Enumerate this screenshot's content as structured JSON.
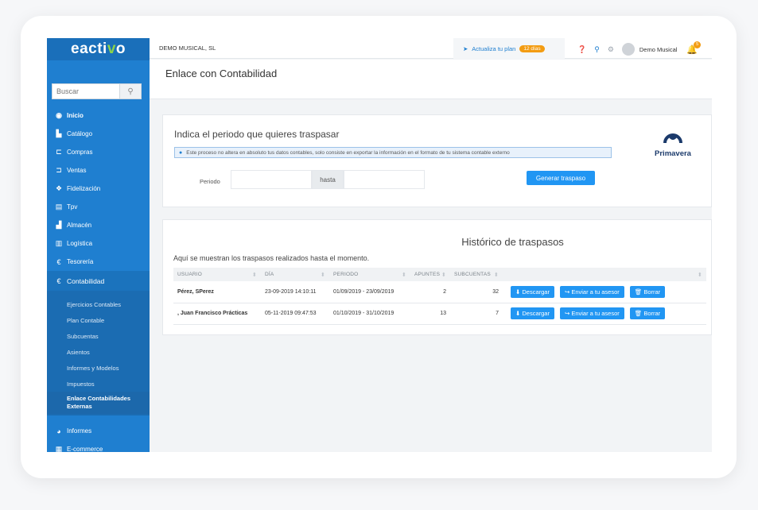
{
  "brand": {
    "prefix": "eacti",
    "v": "v",
    "suffix": "o"
  },
  "search": {
    "placeholder": "Buscar"
  },
  "nav": [
    {
      "icon": "home-icon",
      "glyph": "◉",
      "label": "Inicio"
    },
    {
      "icon": "catalog-icon",
      "glyph": "▙",
      "label": "Catálogo"
    },
    {
      "icon": "purchases-icon",
      "glyph": "⊏",
      "label": "Compras"
    },
    {
      "icon": "sales-icon",
      "glyph": "⊐",
      "label": "Ventas"
    },
    {
      "icon": "gift-icon",
      "glyph": "❖",
      "label": "Fidelización"
    },
    {
      "icon": "tpv-icon",
      "glyph": "▤",
      "label": "Tpv"
    },
    {
      "icon": "warehouse-icon",
      "glyph": "▟",
      "label": "Almacén"
    },
    {
      "icon": "logistics-icon",
      "glyph": "▥",
      "label": "Logística"
    },
    {
      "icon": "treasury-icon",
      "glyph": "€",
      "label": "Tesorería"
    }
  ],
  "nav_section": {
    "glyph": "€",
    "label": "Contabilidad"
  },
  "submenu": [
    "Ejercicios Contables",
    "Plan Contable",
    "Subcuentas",
    "Asientos",
    "Informes y Modelos",
    "Impuestos"
  ],
  "submenu_current": "Enlace Contabilidades Externas",
  "nav_bottom": [
    {
      "icon": "reports-icon",
      "glyph": "◕",
      "label": "Informes"
    },
    {
      "icon": "ecommerce-icon",
      "glyph": "▦",
      "label": "E-commerce"
    }
  ],
  "topbar": {
    "company": "DEMO MUSICAL, SL",
    "upgrade_label": "Actualiza tu plan",
    "upgrade_badge": "12 días",
    "user": "Demo Musical",
    "bell_count": "5"
  },
  "page": {
    "title": "Enlace con Contabilidad"
  },
  "period_panel": {
    "title": "Indica el periodo que quieres traspasar",
    "info": "Este proceso no altera en absoluto tus datos contables, solo consiste en exportar la información en el formato de tu sistema contable externo",
    "period_label": "Periodo",
    "to_label": "hasta",
    "generate_button": "Generar traspaso",
    "software": "Primavera"
  },
  "history": {
    "title": "Histórico de traspasos",
    "subtitle": "Aquí se muestran los traspasos realizados hasta el momento.",
    "columns": [
      "USUARIO",
      "DÍA",
      "PERIODO",
      "APUNTES",
      "SUBCUENTAS"
    ],
    "rows": [
      {
        "user": "Pérez, SPerez",
        "day": "23-09-2019 14:10:11",
        "period": "01/09/2019 - 23/09/2019",
        "entries": "2",
        "accounts": "32"
      },
      {
        "user": ", Juan Francisco Prácticas",
        "day": "05-11-2019 09:47:53",
        "period": "01/10/2019 - 31/10/2019",
        "entries": "13",
        "accounts": "7"
      }
    ],
    "actions": {
      "download": "Descargar",
      "send": "Enviar a tu asesor",
      "delete": "Borrar"
    }
  }
}
